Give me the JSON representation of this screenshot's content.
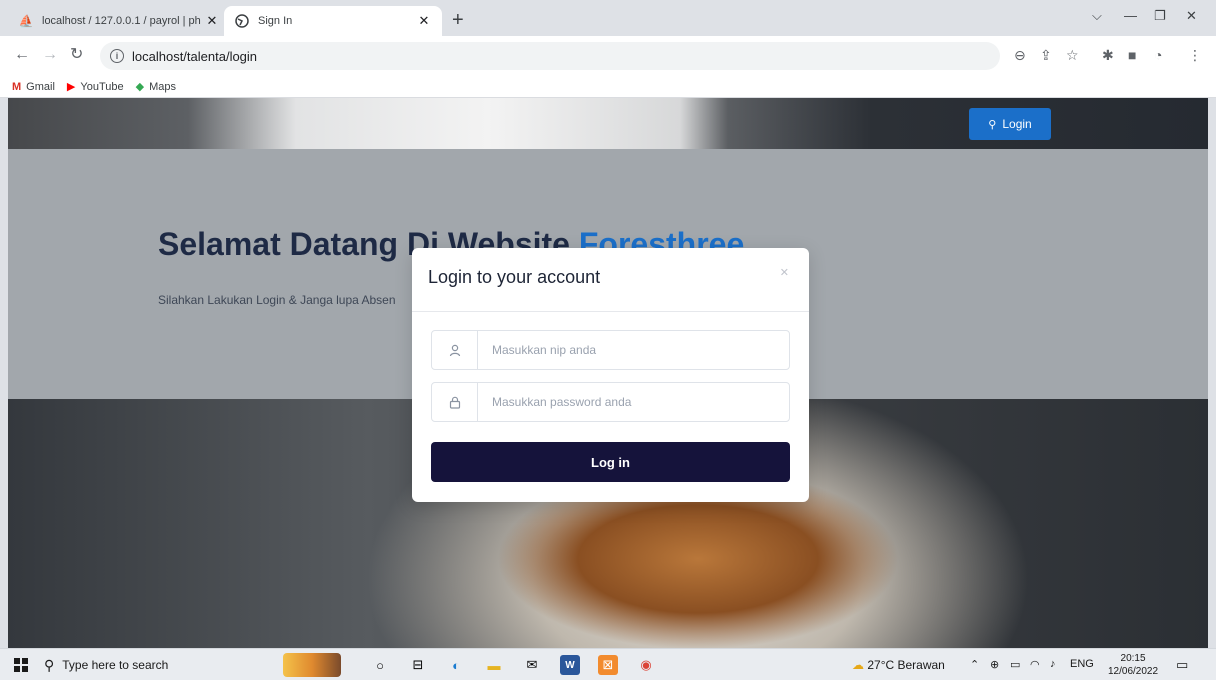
{
  "browser": {
    "tabs": [
      {
        "title": "localhost / 127.0.0.1 / payrol | ph",
        "icon": "phpmyadmin-icon"
      },
      {
        "title": "Sign In",
        "icon": "globe-icon"
      }
    ],
    "url": "localhost/talenta/login",
    "bookmarks": [
      {
        "label": "Gmail",
        "icon": "gmail-icon"
      },
      {
        "label": "YouTube",
        "icon": "youtube-icon"
      },
      {
        "label": "Maps",
        "icon": "maps-icon"
      }
    ]
  },
  "page": {
    "nav_login_label": "Login",
    "hero_title": "Selamat Datang Di Website",
    "hero_brand": "Foresthree",
    "hero_subtitle": "Silahkan Lakukan Login & Janga lupa Absen"
  },
  "modal": {
    "title": "Login to your account",
    "nip_placeholder": "Masukkan nip anda",
    "password_placeholder": "Masukkan password anda",
    "submit_label": "Log in"
  },
  "taskbar": {
    "search_placeholder": "Type here to search",
    "weather": "27°C  Berawan",
    "language": "ENG",
    "time": "20:15",
    "date": "12/06/2022"
  },
  "colors": {
    "accent": "#1b6fc9",
    "button_dark": "#15133b",
    "title_dark": "#1e2a45"
  }
}
